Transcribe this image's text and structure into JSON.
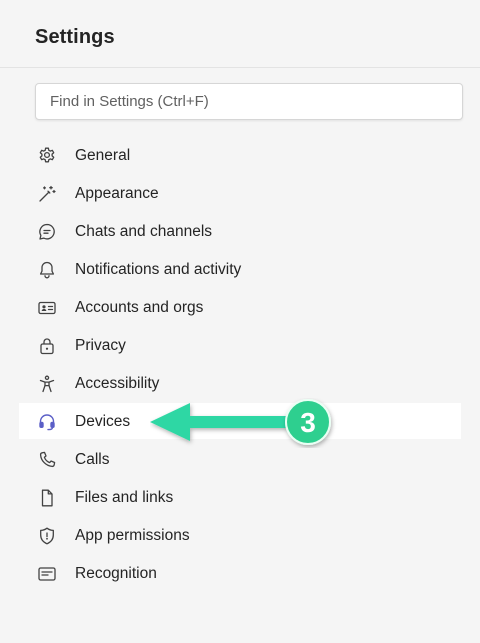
{
  "header": {
    "title": "Settings"
  },
  "search": {
    "placeholder": "Find in Settings (Ctrl+F)"
  },
  "nav": {
    "items": [
      {
        "label": "General",
        "icon": "gear-icon"
      },
      {
        "label": "Appearance",
        "icon": "magic-wand-icon"
      },
      {
        "label": "Chats and channels",
        "icon": "chat-bubble-icon"
      },
      {
        "label": "Notifications and activity",
        "icon": "bell-icon"
      },
      {
        "label": "Accounts and orgs",
        "icon": "contact-card-icon"
      },
      {
        "label": "Privacy",
        "icon": "lock-icon"
      },
      {
        "label": "Accessibility",
        "icon": "accessibility-icon"
      },
      {
        "label": "Devices",
        "icon": "headset-icon",
        "selected": true
      },
      {
        "label": "Calls",
        "icon": "phone-icon"
      },
      {
        "label": "Files and links",
        "icon": "document-icon"
      },
      {
        "label": "App permissions",
        "icon": "shield-icon"
      },
      {
        "label": "Recognition",
        "icon": "recognition-icon"
      }
    ]
  },
  "annotation": {
    "step": "3",
    "arrow_color": "#2fd7a4",
    "circle_color": "#2fcf8f"
  },
  "colors": {
    "background": "#f5f5f5",
    "selected_row": "#ffffff",
    "accent": "#5b5fc7",
    "text": "#242424"
  }
}
